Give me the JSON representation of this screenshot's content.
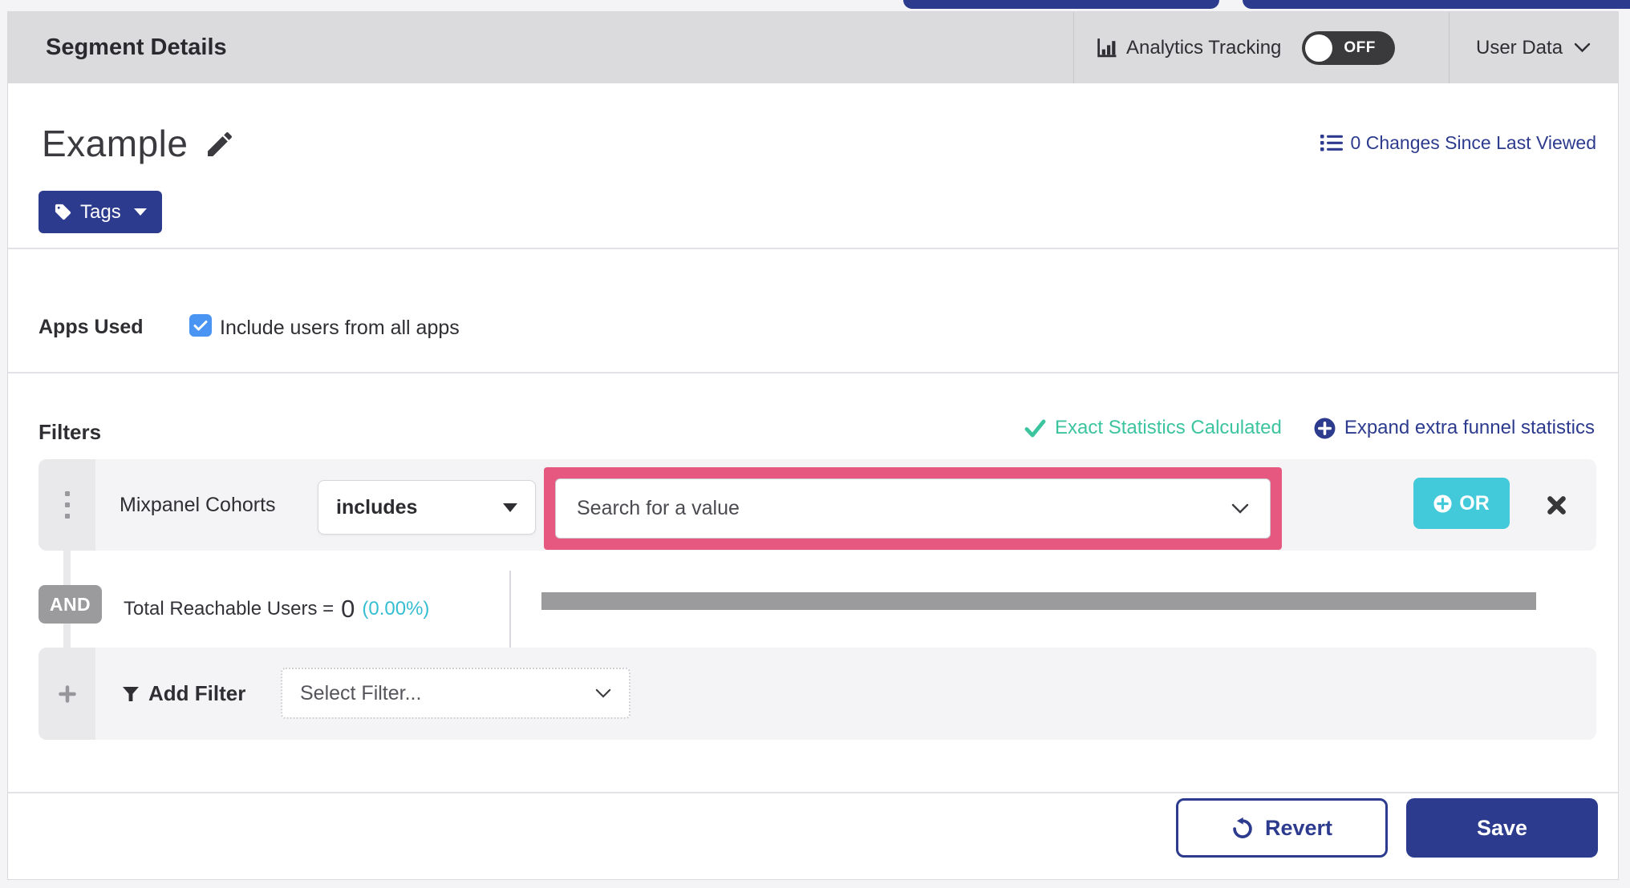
{
  "header": {
    "title": "Segment Details",
    "analytics_tracking_label": "Analytics Tracking",
    "toggle_state": "OFF",
    "user_data_label": "User Data"
  },
  "segment": {
    "name": "Example",
    "tags_button_label": "Tags",
    "changes_link": "0 Changes Since Last Viewed"
  },
  "apps_used": {
    "section_label": "Apps Used",
    "checkbox_label": "Include users from all apps",
    "checkbox_checked": true
  },
  "filters": {
    "section_label": "Filters",
    "exact_statistics_label": "Exact Statistics Calculated",
    "expand_funnel_label": "Expand extra funnel statistics",
    "filter_row": {
      "field_label": "Mixpanel Cohorts",
      "operator_value": "includes",
      "value_placeholder": "Search for a value",
      "or_button_label": "OR"
    },
    "and_label": "AND",
    "total_reachable": {
      "label": "Total Reachable Users =",
      "value": "0",
      "percent": "(0.00%)",
      "progress_fraction": 0
    },
    "add_filter": {
      "label": "Add Filter",
      "select_placeholder": "Select Filter..."
    }
  },
  "footer": {
    "revert_label": "Revert",
    "save_label": "Save"
  },
  "colors": {
    "indigo": "#2d3b8e",
    "teal": "#42cadb",
    "green": "#3cc49f",
    "cyan": "#35bed2",
    "pink_highlight": "#e75881",
    "badge_gray": "#9b9b9e",
    "checkbox_blue": "#4a94f4",
    "header_gray": "#dbdbde"
  }
}
